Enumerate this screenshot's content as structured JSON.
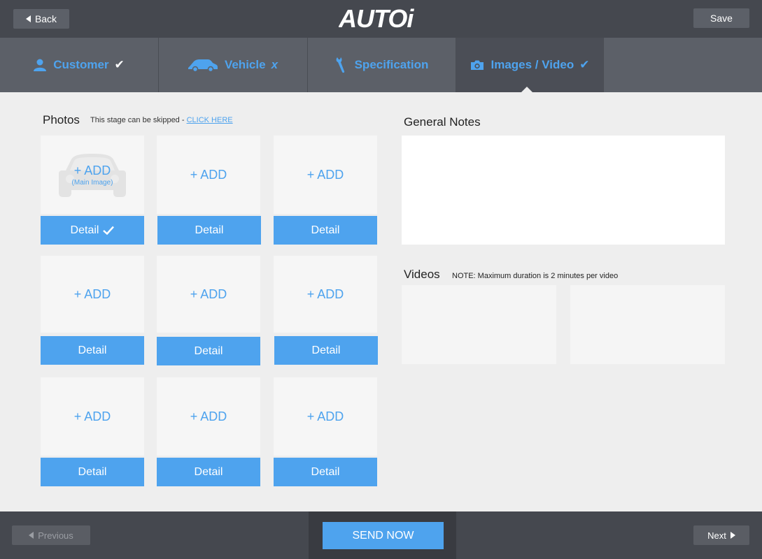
{
  "header": {
    "back_label": "Back",
    "logo_text": "AUTOi",
    "save_label": "Save"
  },
  "tabs": [
    {
      "label": "Customer",
      "icon": "person-icon",
      "status": "✔"
    },
    {
      "label": "Vehicle",
      "icon": "car-icon",
      "status": "x"
    },
    {
      "label": "Specification",
      "icon": "wrench-icon",
      "status": ""
    },
    {
      "label": "Images / Video",
      "icon": "camera-icon",
      "status": "✔",
      "active": true
    }
  ],
  "photos": {
    "title": "Photos",
    "skip_text": "This stage can be skipped - ",
    "skip_link": "CLICK HERE",
    "main_image_label": "(Main Image)",
    "add_label": "+ ADD",
    "detail_label": "Detail",
    "first_detail_done": true
  },
  "notes": {
    "title": "General Notes",
    "value": ""
  },
  "videos": {
    "title": "Videos",
    "note": "NOTE:  Maximum duration is 2 minutes per video"
  },
  "footer": {
    "previous_label": "Previous",
    "send_label": "SEND NOW",
    "next_label": "Next"
  },
  "colors": {
    "accent": "#4ea3ee",
    "header_bg": "#45484f",
    "tabs_bg": "#5c6068",
    "content_bg": "#eeeeee"
  }
}
